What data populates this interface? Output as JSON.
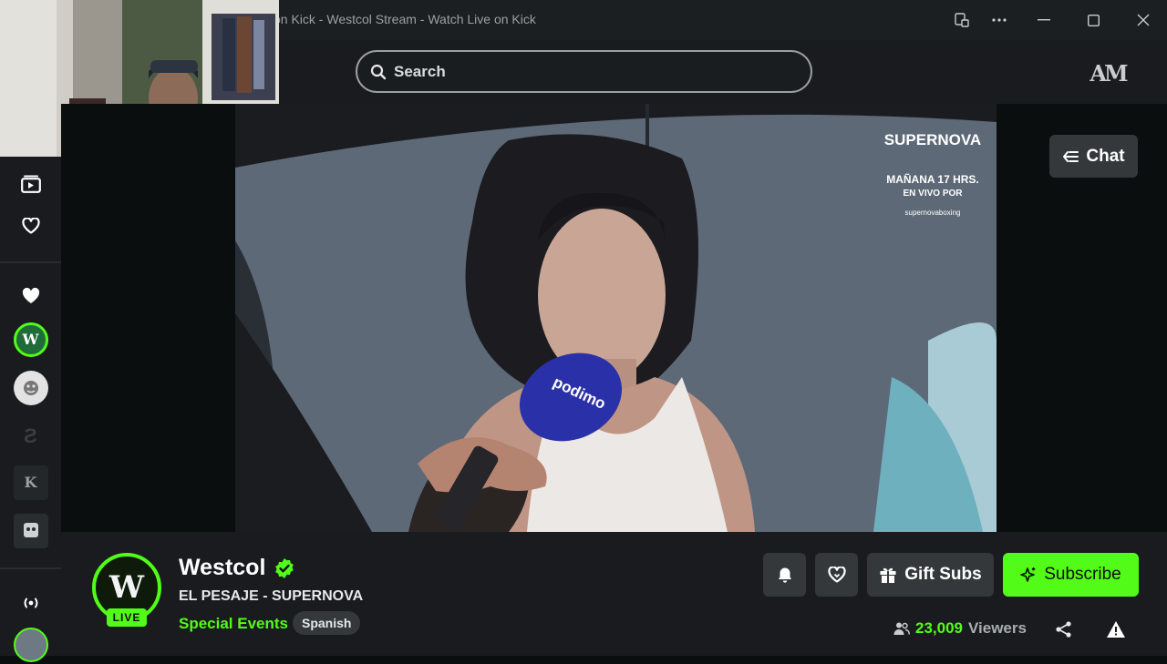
{
  "window": {
    "title": "on Kick - Westcol Stream - Watch Live on Kick",
    "controls": [
      "apps-icon",
      "more-icon",
      "minimize-icon",
      "maximize-icon",
      "close-icon"
    ]
  },
  "topbar": {
    "search_placeholder": "Search",
    "user_avatar_text": "AM"
  },
  "sidebar": {
    "items": [
      {
        "name": "following-videos",
        "icon": "video-library-icon"
      },
      {
        "name": "favorites",
        "icon": "heart-outline-icon"
      },
      {
        "name": "following",
        "icon": "heart-filled-icon"
      }
    ],
    "channels": [
      {
        "name": "westcol",
        "text": "W",
        "color": "#1f6b3a",
        "live": true
      },
      {
        "name": "channel-2",
        "text": "",
        "color": "#d9d9d9",
        "live": false
      },
      {
        "name": "channel-3",
        "text": "",
        "color": "#2a2d30",
        "live": false
      },
      {
        "name": "channel-4",
        "text": "K",
        "color": "#2a2d30",
        "live": false
      },
      {
        "name": "channel-5",
        "text": "",
        "color": "#2a2d30",
        "live": false
      }
    ],
    "bottom_icon": "live-broadcast-icon"
  },
  "video": {
    "overlay_brand": "SUPERNOVA",
    "overlay_line1": "MAÑANA 17 HRS.",
    "overlay_line2": "EN VIVO POR",
    "overlay_handle": "supernovaboxing",
    "mic_brand": "podimo"
  },
  "chat_button": {
    "label": "Chat",
    "icon": "collapse-left-icon"
  },
  "channel": {
    "name": "Westcol",
    "verified": true,
    "live_badge": "LIVE",
    "avatar_letter": "W",
    "stream_title": "EL PESAJE - SUPERNOVA",
    "category": "Special Events",
    "language": "Spanish"
  },
  "actions": {
    "notify_icon": "bell-icon",
    "follow_icon": "heart-outline-icon",
    "gift_label": "Gift Subs",
    "gift_icon": "gift-icon",
    "subscribe_label": "Subscribe",
    "subscribe_icon": "sparkle-icon"
  },
  "stats": {
    "viewer_count": "23,009",
    "viewer_label": "Viewers",
    "share_icon": "share-icon",
    "report_icon": "warning-icon"
  },
  "colors": {
    "accent": "#53fc18",
    "surface": "#191b1f",
    "button": "#34383b",
    "background": "#0b0e0f"
  }
}
